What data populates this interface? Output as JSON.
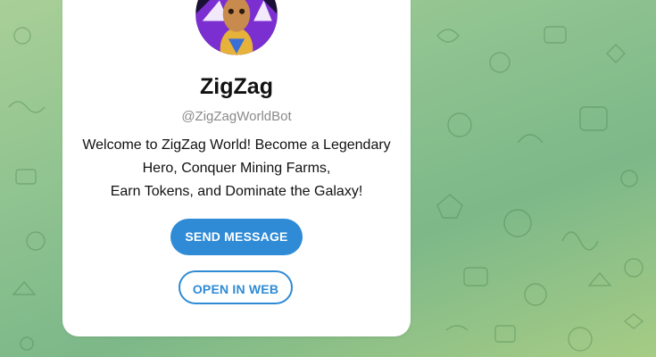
{
  "colors": {
    "accent": "#2f8bd6",
    "card_background": "#ffffff",
    "wallpaper": "#8fc390"
  },
  "profile": {
    "avatar_icon": "bot-avatar-icon",
    "name": "ZigZag",
    "username": "@ZigZagWorldBot",
    "description_lines": [
      "Welcome to ZigZag World! Become a Legendary",
      "Hero, Conquer Mining Farms,",
      "Earn Tokens, and Dominate the Galaxy!"
    ]
  },
  "actions": {
    "send_message_label": "SEND MESSAGE",
    "open_in_web_label": "OPEN IN WEB"
  }
}
